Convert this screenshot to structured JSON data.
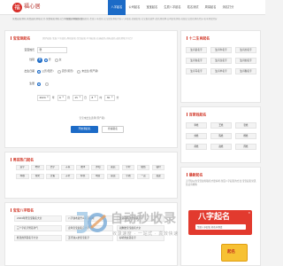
{
  "header": {
    "logo_char": "福",
    "logo_text": "福心居",
    "tagline": "免费起名测名,免费起名测名打分,免费取名测名打分测试名字网站免费,",
    "nav": [
      "八字起名",
      "公司起名",
      "宝宝起名",
      "生辰八字起名",
      "姓名测试",
      "周易起名",
      "测名打分"
    ]
  },
  "announce": "免费起名取名,在线起名,生辰八字起名,宝宝起名测名打分,八字取名,周易起名,宝宝取名软件,起名测名网,公司起名测名,在线宝宝起名测名打分,名字测试打分",
  "form": {
    "title": "宝宝测起名",
    "desc": "国学起名,生辰八字起名,周易起名,宝宝起名,公司起名,店铺起名,商标起名,起名测名字打分",
    "surname_label": "宝宝姓氏",
    "surname_value": "张",
    "gender_label": "性别",
    "gender_badge": "男",
    "gender_male": "男",
    "gender_female": "女",
    "birth_label": "出生日期",
    "date_options": [
      "公历(阳历)",
      "农历(阴历)",
      "未出生(预产期)"
    ],
    "zodiac_label": "生辰",
    "birth_year": "2024",
    "year_unit": "年",
    "birth_month": "6",
    "month_unit": "月",
    "birth_day": "15",
    "day_unit": "日",
    "birth_hour": "8",
    "hour_unit": "时",
    "birth_minute": "30",
    "minute_unit": "分",
    "hint": "宝宝未出生选择(预产期)",
    "submit": "开始测起名",
    "secondary": "查看取名"
  },
  "names": {
    "title": "男孩热门起名",
    "items": [
      "宸宇",
      "皓轩",
      "浩宇",
      "子墨",
      "瑞泽",
      "沐阳",
      "奕辰",
      "宇轩",
      "俊熙",
      "铭轩",
      "梓睿",
      "博文",
      "天佑",
      "子轩",
      "梓豪",
      "明哲",
      "思远",
      "宇航",
      "一诺",
      "嘉懿"
    ]
  },
  "articles": {
    "title": "宝宝八字取名",
    "items": [
      "2024年男宝宝取名大全",
      "八字缺木起什么名字好听",
      "女孩取名诗经楚辞",
      "三个字名字男孩洋气",
      "龙年宝宝起名宜用字",
      "双胞胎宝宝起名大全",
      "姓张的男孩名字大全",
      "五行缺火的宝宝名字",
      "好听的女孩名字"
    ]
  },
  "zodiac": {
    "title": "十二生肖起名",
    "items": [
      "生肖鼠名字",
      "生肖牛名字",
      "生肖虎名字",
      "生肖兔名字",
      "生肖龙名字",
      "生肖蛇名字",
      "生肖马名字",
      "生肖羊名字",
      "生肖猴名字"
    ]
  },
  "surnames": {
    "title": "百家姓起名",
    "items": [
      "李姓",
      "王姓",
      "张姓",
      "刘姓",
      "陈姓",
      "杨姓",
      "黄姓",
      "赵姓",
      "周姓"
    ]
  },
  "recent": {
    "title": "最新起名",
    "text": "五行缺火的宝宝如何取名才更好听,生辰八字起名的方法,宝宝起名常见禁忌有哪些"
  },
  "ad": {
    "title": "八字起名",
    "sub": "生辰八字起名 好名字测试",
    "close": "✕",
    "card": "起名"
  },
  "watermark": {
    "title": "自动秒收录",
    "sub": "收录速度 · 一站式 · 高效快速"
  }
}
